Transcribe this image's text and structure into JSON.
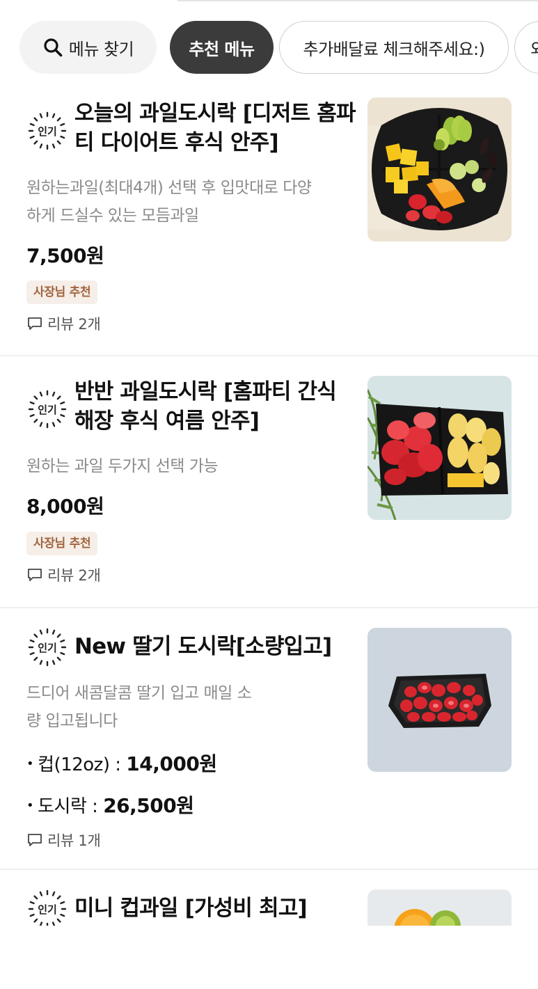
{
  "chips": {
    "search_label": "메뉴 찾기",
    "active_label": "추천 메뉴",
    "notice_label": "추가배달료 체크해주세요:)",
    "cut_label": "외"
  },
  "badge_label": "인기",
  "items": [
    {
      "title": "오늘의 과일도시락 [디저트 홈파티 다이어트 후식 안주]",
      "desc": "원하는과일(최대4개) 선택 후 입맛대로 다양하게 드실수 있는 모듬과일",
      "price": "7,500원",
      "tag": "사장님 추천",
      "review": "리뷰 2개"
    },
    {
      "title": "반반 과일도시락 [홈파티 간식 해장 후식 여름 안주]",
      "desc": "원하는 과일 두가지 선택 가능",
      "price": "8,000원",
      "tag": "사장님 추천",
      "review": "리뷰 2개"
    },
    {
      "title": "New 딸기 도시락[소량입고]",
      "desc": "드디어 새콤달콤 딸기 입고 매일 소량 입고됩니다",
      "options": [
        {
          "bullet": "•",
          "name": "컵(12oz) :",
          "price": "14,000원"
        },
        {
          "bullet": "•",
          "name": "도시락 :",
          "price": "26,500원"
        }
      ],
      "review": "리뷰 1개"
    },
    {
      "title": "미니 컵과일 [가성비 최고]"
    }
  ],
  "colors": {
    "active_chip": "#3b3b3b",
    "tag_bg": "#f6eee8",
    "tag_text": "#a0643c",
    "desc_text": "#8a8a8a"
  },
  "icons": {
    "search": "search-icon",
    "review": "speech-bubble-icon",
    "badge": "popular-badge-icon"
  }
}
